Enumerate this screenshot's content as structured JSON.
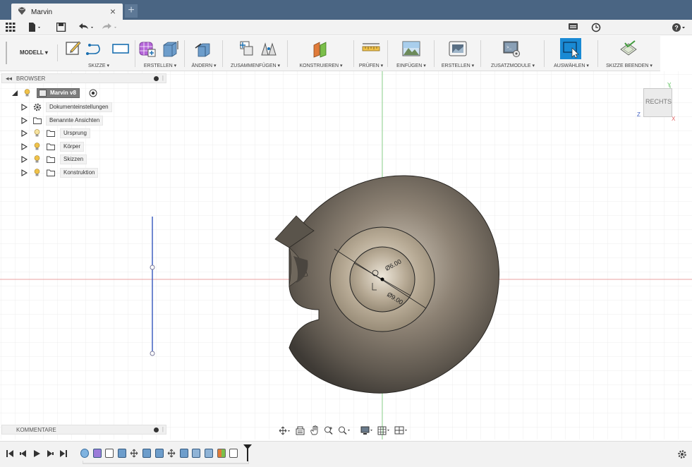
{
  "window": {
    "tab_title": "Marvin",
    "tab_close": "×",
    "new_tab": "+"
  },
  "quickbar": {
    "grid_icon": "apps-grid-icon",
    "file_icon": "file-icon",
    "save_icon": "save-icon",
    "undo_icon": "undo-icon",
    "redo_icon": "redo-icon",
    "job_status_icon": "job-status-icon",
    "history_icon": "clock-icon",
    "help_icon": "help-icon",
    "help_label": "?"
  },
  "ribbon": {
    "workspace": "MODELL ▾",
    "groups": [
      {
        "label": "SKIZZE ▾"
      },
      {
        "label": "ERSTELLEN ▾"
      },
      {
        "label": "ÄNDERN ▾"
      },
      {
        "label": "ZUSAMMENFÜGEN ▾"
      },
      {
        "label": "KONSTRUIEREN ▾"
      },
      {
        "label": "PRÜFEN ▾"
      },
      {
        "label": "EINFÜGEN ▾"
      },
      {
        "label": "ERSTELLEN ▾"
      },
      {
        "label": "ZUSATZMODULE ▾"
      },
      {
        "label": "AUSWÄHLEN ▾"
      },
      {
        "label": "SKIZZE BEENDEN ▾"
      }
    ]
  },
  "browser": {
    "title": "BROWSER",
    "collapse": "◂◂",
    "root": "Marvin v8",
    "items": [
      {
        "label": "Dokumenteinstellungen",
        "icon": "gear-icon",
        "bulb": false
      },
      {
        "label": "Benannte Ansichten",
        "icon": "folder-icon",
        "bulb": false
      },
      {
        "label": "Ursprung",
        "icon": "folder-icon",
        "bulb": true,
        "bulb_off": true
      },
      {
        "label": "Körper",
        "icon": "folder-icon",
        "bulb": true
      },
      {
        "label": "Skizzen",
        "icon": "folder-icon",
        "bulb": true
      },
      {
        "label": "Konstruktion",
        "icon": "folder-icon",
        "bulb": true
      }
    ]
  },
  "viewcube": {
    "face": "RECHTS",
    "axis_y": "Y",
    "axis_z": "Z",
    "axis_x": "X"
  },
  "dimensions": {
    "inner": "Ø6.00",
    "outer": "Ø9.00"
  },
  "comments": {
    "title": "KOMMENTARE"
  },
  "colors": {
    "titlebar": "#4a6583",
    "axis_red": "#e06060",
    "axis_green": "#5cc05c",
    "axis_blue": "#4060c0",
    "select_blue": "#1a8ad4"
  }
}
